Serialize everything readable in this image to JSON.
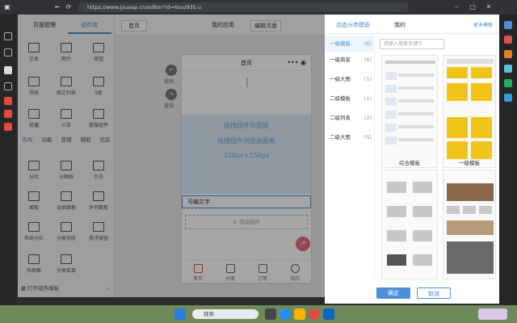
{
  "browser": {
    "url": "https://www.jsuaap.cn/editor?id=6ou/935.u",
    "buttons": [
      "←",
      "→",
      "⟳"
    ]
  },
  "left_panel": {
    "tabs": [
      "页面管理",
      "组件库"
    ],
    "components_row1": [
      "文本",
      "图片",
      "按钮"
    ],
    "components_row2": [
      "导航",
      "图文列表",
      "S板"
    ],
    "components_row3": [
      "轮播",
      "公告",
      "客服组件"
    ],
    "categories": [
      "布局",
      "功能",
      "营销",
      "辅助",
      "社区"
    ],
    "layout_row1": [
      "分栏",
      "分割线",
      "空白"
    ],
    "layout_row2": [
      "面板",
      "自由面板",
      "多列面板"
    ],
    "layout_row3": [
      "布局分栏",
      "分类导航",
      "悬浮按钮"
    ],
    "layout_row4": [
      "布局面",
      "分类菜单"
    ],
    "footer": "打开组件模板"
  },
  "center": {
    "topbar_left": "首页",
    "topbar_mid": "我的应用",
    "topbar_right": "编辑页面",
    "side_labels": [
      "撤销",
      "重做"
    ],
    "phone_title": "首页",
    "drop_line1": "拖拽组件到面板",
    "drop_line2": "拖拽组件到自由面板",
    "drop_size": "320px×150px",
    "text_component": "可编文字",
    "add_component": "⊕ 添加组件",
    "tabbar": [
      "首页",
      "分类",
      "订单",
      "我的"
    ]
  },
  "modal": {
    "title_left": "动态分类模板",
    "title_mid": "我的",
    "title_right": "更多模板",
    "categories": [
      {
        "label": "一级模板",
        "count": "(6)"
      },
      {
        "label": "一级商家",
        "count": "(6)"
      },
      {
        "label": "一级大图",
        "count": "(1)"
      },
      {
        "label": "二级模板",
        "count": "(1)"
      },
      {
        "label": "二级列表",
        "count": "(2)"
      },
      {
        "label": "二级大图",
        "count": "(5)"
      }
    ],
    "search_placeholder": "请输入搜索关键字",
    "templates": [
      "综合模板",
      "一级模板"
    ],
    "confirm": "确定",
    "cancel": "取消"
  },
  "taskbar": {
    "search": "搜索"
  },
  "colors": {
    "accent": "#4a90d9",
    "drop_bg": "#dcebf7",
    "taskbar": "#6f8a5a"
  }
}
